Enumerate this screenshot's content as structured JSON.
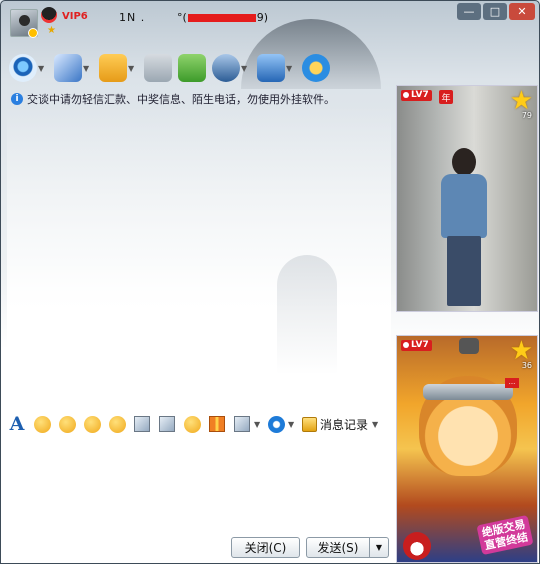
{
  "titlebar": {
    "vip_label": "VIP6",
    "contact_name": "1N .",
    "contact_id_prefix": "°(",
    "contact_id_suffix": "9)",
    "minimize_glyph": "—",
    "maximize_glyph": "□",
    "close_glyph": "✕"
  },
  "toolbar": {
    "items": [
      {
        "icon": "webcam-icon",
        "has_dropdown": true
      },
      {
        "icon": "microphone-icon",
        "has_dropdown": true
      },
      {
        "icon": "send-file-icon",
        "has_dropdown": true
      },
      {
        "icon": "mail-icon",
        "has_dropdown": false
      },
      {
        "icon": "create-group-icon",
        "has_dropdown": false
      },
      {
        "icon": "contact-user-icon",
        "has_dropdown": true
      },
      {
        "icon": "remote-desktop-icon",
        "has_dropdown": true
      },
      {
        "icon": "app-browser-icon",
        "has_dropdown": false
      }
    ],
    "dropdown_glyph": "▼"
  },
  "notice": {
    "icon": "info-icon",
    "icon_glyph": "i",
    "text": "交谈中请勿轻信汇款、中奖信息、陌生电话，勿使用外挂软件。"
  },
  "format_bar": {
    "font_glyph": "A",
    "history_label": "消息记录",
    "dropdown_glyph": "▼"
  },
  "buttons": {
    "close_label": "关闭(C)",
    "send_label": "发送(S)",
    "send_dropdown_glyph": "▼"
  },
  "show_panel": {
    "top": {
      "level": "LV7",
      "year_tag": "年",
      "star_glyph": "★",
      "star_count": "79"
    },
    "bottom": {
      "level": "LV7",
      "star_glyph": "★",
      "star_count": "36",
      "tag": "...",
      "stamp_text": "绝版交易 直营终结"
    }
  },
  "colors": {
    "vip_red": "#e02020",
    "badge_red": "#d81e1e",
    "accent_blue": "#1d5fb0",
    "star_gold": "#ffcc18",
    "minimize_button_bg": "#5d6f80",
    "maximize_button_bg": "#5d6f80",
    "close_button_bg": "#c94a3c"
  }
}
